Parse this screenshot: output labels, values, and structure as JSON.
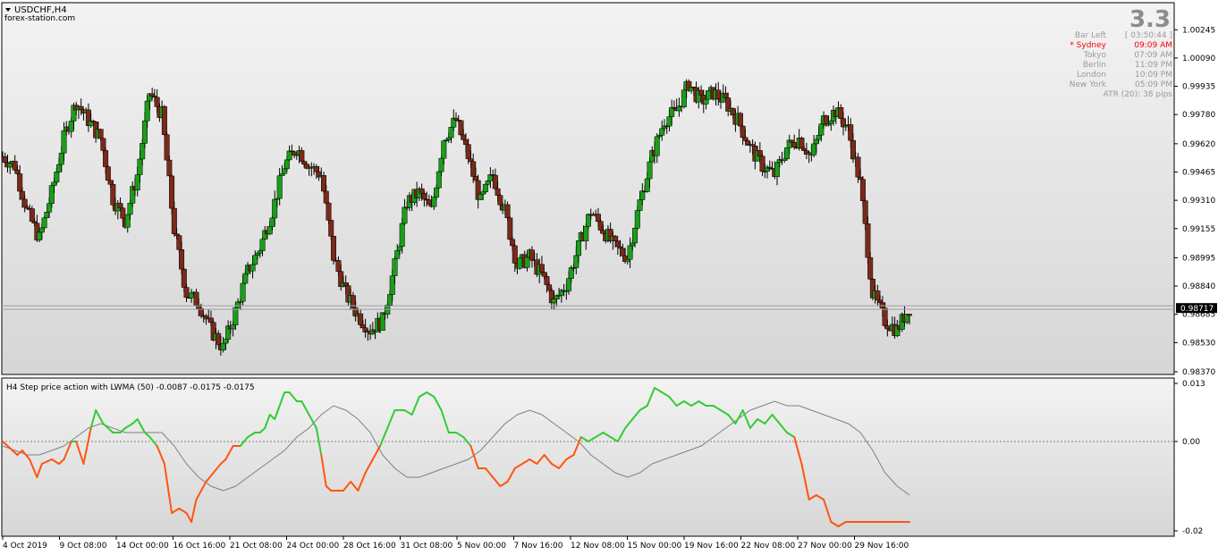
{
  "window": {
    "title": "USDCHF,H4",
    "watermark": "forex-station.com"
  },
  "info_panel": {
    "spread": "3.3",
    "bar_left_label": "Bar Left",
    "bar_left_value": "[ 03:50:44 ]",
    "sessions": [
      {
        "name": "* Sydney",
        "time": "09:09 AM",
        "active": true
      },
      {
        "name": "Tokyo",
        "time": "07:09 AM",
        "active": false
      },
      {
        "name": "Berlin",
        "time": "11:09 PM",
        "active": false
      },
      {
        "name": "London",
        "time": "10:09 PM",
        "active": false
      },
      {
        "name": "New York",
        "time": "05:09 PM",
        "active": false
      }
    ],
    "atr": "ATR (20): 38 pips"
  },
  "indicator": {
    "label": "H4 Step price action with LWMA (50) -0.0087 -0.0175 -0.0175"
  },
  "colors": {
    "bull_candle": "#1a9e1a",
    "bear_candle": "#7a2a1a",
    "wick": "#000000",
    "step_up": "#33cc33",
    "step_down": "#ff5511",
    "lwma": "#808080",
    "price_line": "#a0a0a0",
    "current_price_bg": "#000000",
    "sydney_active": "#ff0000",
    "info_text": "#999999"
  },
  "chart_data": [
    {
      "type": "candlestick",
      "symbol": "USDCHF",
      "timeframe": "H4",
      "current_price": 0.98717,
      "current_price_label": "0.98717",
      "ylim": [
        0.9837,
        1.0031
      ],
      "y_ticks": [
        1.00245,
        1.0009,
        0.99935,
        0.9978,
        0.9962,
        0.99465,
        0.9931,
        0.99155,
        0.98995,
        0.9884,
        0.98685,
        0.9853,
        0.9837
      ],
      "y_tick_labels": [
        "1.00245",
        "1.00090",
        "0.99935",
        "0.99780",
        "0.99620",
        "0.99465",
        "0.99310",
        "0.99155",
        "0.98995",
        "0.98840",
        "0.98685",
        "0.98530",
        "0.98370"
      ],
      "x_tick_labels": [
        "4 Oct 2019",
        "9 Oct 08:00",
        "14 Oct 00:00",
        "16 Oct 16:00",
        "21 Oct 08:00",
        "24 Oct 00:00",
        "28 Oct 16:00",
        "31 Oct 08:00",
        "5 Nov 00:00",
        "7 Nov 16:00",
        "12 Nov 08:00",
        "15 Nov 00:00",
        "19 Nov 16:00",
        "22 Nov 08:00",
        "27 Nov 00:00",
        "29 Nov 16:00"
      ],
      "close_path": [
        [
          0,
          0.9955
        ],
        [
          5,
          0.995
        ],
        [
          10,
          0.9925
        ],
        [
          15,
          0.991
        ],
        [
          20,
          0.9935
        ],
        [
          25,
          0.9965
        ],
        [
          30,
          0.9985
        ],
        [
          35,
          0.9975
        ],
        [
          40,
          0.9965
        ],
        [
          45,
          0.9932
        ],
        [
          50,
          0.992
        ],
        [
          55,
          0.9945
        ],
        [
          60,
          0.999
        ],
        [
          65,
          0.9978
        ],
        [
          70,
          0.9915
        ],
        [
          75,
          0.988
        ],
        [
          80,
          0.9875
        ],
        [
          85,
          0.986
        ],
        [
          90,
          0.985
        ],
        [
          95,
          0.987
        ],
        [
          100,
          0.9892
        ],
        [
          105,
          0.9905
        ],
        [
          110,
          0.9925
        ],
        [
          115,
          0.995
        ],
        [
          120,
          0.996
        ],
        [
          125,
          0.995
        ],
        [
          130,
          0.9945
        ],
        [
          135,
          0.99
        ],
        [
          140,
          0.988
        ],
        [
          145,
          0.9868
        ],
        [
          150,
          0.986
        ],
        [
          155,
          0.9865
        ],
        [
          160,
          0.9895
        ],
        [
          165,
          0.993
        ],
        [
          170,
          0.9935
        ],
        [
          175,
          0.9925
        ],
        [
          180,
          0.9965
        ],
        [
          185,
          0.9975
        ],
        [
          190,
          0.9955
        ],
        [
          195,
          0.993
        ],
        [
          200,
          0.9945
        ],
        [
          205,
          0.9925
        ],
        [
          210,
          0.9895
        ],
        [
          215,
          0.99
        ],
        [
          220,
          0.989
        ],
        [
          225,
          0.9875
        ],
        [
          230,
          0.9885
        ],
        [
          235,
          0.9905
        ],
        [
          240,
          0.9925
        ],
        [
          245,
          0.9915
        ],
        [
          250,
          0.9905
        ],
        [
          255,
          0.99
        ],
        [
          260,
          0.993
        ],
        [
          265,
          0.9955
        ],
        [
          270,
          0.9975
        ],
        [
          275,
          0.998
        ],
        [
          280,
          0.9995
        ],
        [
          285,
          0.9985
        ],
        [
          290,
          0.999
        ],
        [
          295,
          0.9985
        ],
        [
          300,
          0.9975
        ],
        [
          305,
          0.996
        ],
        [
          310,
          0.995
        ],
        [
          315,
          0.9945
        ],
        [
          320,
          0.996
        ],
        [
          325,
          0.9965
        ],
        [
          330,
          0.9955
        ],
        [
          335,
          0.9975
        ],
        [
          340,
          0.998
        ],
        [
          345,
          0.997
        ],
        [
          350,
          0.994
        ],
        [
          355,
          0.988
        ],
        [
          360,
          0.9865
        ],
        [
          365,
          0.986
        ],
        [
          370,
          0.9872
        ]
      ]
    },
    {
      "type": "line",
      "title": "H4 Step price action with LWMA (50)",
      "ylim": [
        -0.02,
        0.013
      ],
      "y_ticks": [
        0.013,
        0.0,
        -0.02
      ],
      "y_tick_labels": [
        "0.013",
        "0.00",
        "-0.02"
      ],
      "zero_line": 0.0,
      "series": [
        {
          "color": "step",
          "x": [
            0,
            4,
            6,
            8,
            11,
            14,
            16,
            20,
            23,
            25,
            28,
            30,
            33,
            36,
            38,
            41,
            45,
            48,
            50,
            53,
            55,
            58,
            60,
            63,
            66,
            69,
            72,
            75,
            77,
            79,
            81,
            83,
            86,
            89,
            91,
            94,
            97,
            100,
            103,
            105,
            107,
            109,
            111,
            113,
            115,
            117,
            120,
            122,
            125,
            128,
            130,
            132,
            134,
            137,
            139,
            142,
            145,
            148,
            151,
            154,
            157,
            160,
            162,
            164,
            167,
            170,
            173,
            176,
            179,
            182,
            185,
            188,
            191,
            194,
            197,
            200,
            203,
            206,
            209,
            212,
            215,
            218,
            221,
            224,
            227,
            230,
            233,
            236,
            239,
            242,
            245,
            248,
            251,
            254,
            257,
            260,
            263,
            266,
            269,
            272,
            275,
            278,
            281,
            284,
            287,
            290,
            293,
            296,
            299,
            302,
            305,
            308,
            311,
            314,
            317,
            320,
            323,
            326,
            329,
            332,
            335,
            338,
            341,
            344,
            347,
            350,
            352,
            355,
            358,
            361,
            364,
            367,
            370
          ],
          "y": [
            0.0,
            -0.002,
            -0.003,
            -0.002,
            -0.004,
            -0.008,
            -0.005,
            -0.004,
            -0.005,
            -0.004,
            0.0,
            0.0,
            -0.005,
            0.003,
            0.007,
            0.004,
            0.002,
            0.002,
            0.003,
            0.004,
            0.005,
            0.002,
            0.001,
            -0.001,
            -0.005,
            -0.016,
            -0.015,
            -0.016,
            -0.018,
            -0.013,
            -0.011,
            -0.009,
            -0.007,
            -0.005,
            -0.004,
            -0.001,
            -0.001,
            0.001,
            0.002,
            0.002,
            0.003,
            0.006,
            0.005,
            0.008,
            0.011,
            0.011,
            0.009,
            0.009,
            0.006,
            0.003,
            -0.003,
            -0.01,
            -0.011,
            -0.011,
            -0.011,
            -0.009,
            -0.011,
            -0.007,
            -0.004,
            -0.001,
            0.003,
            0.007,
            0.007,
            0.007,
            0.006,
            0.01,
            0.011,
            0.01,
            0.007,
            0.002,
            0.002,
            0.001,
            -0.001,
            -0.006,
            -0.006,
            -0.008,
            -0.01,
            -0.009,
            -0.006,
            -0.005,
            -0.004,
            -0.005,
            -0.003,
            -0.005,
            -0.006,
            -0.004,
            -0.003,
            0.001,
            0.0,
            0.001,
            0.002,
            0.001,
            0.0,
            0.003,
            0.005,
            0.007,
            0.008,
            0.012,
            0.011,
            0.01,
            0.008,
            0.009,
            0.008,
            0.009,
            0.008,
            0.008,
            0.007,
            0.006,
            0.004,
            0.007,
            0.003,
            0.005,
            0.004,
            0.006,
            0.004,
            0.002,
            0.001,
            -0.005,
            -0.013,
            -0.012,
            -0.013,
            -0.018,
            -0.019,
            -0.018,
            -0.018,
            -0.018,
            -0.018,
            -0.018,
            -0.018,
            -0.018,
            -0.018,
            -0.018,
            -0.018
          ]
        },
        {
          "name": "LWMA (50)",
          "color": "lwma",
          "x": [
            0,
            5,
            10,
            15,
            20,
            25,
            30,
            35,
            40,
            45,
            50,
            55,
            60,
            65,
            70,
            75,
            80,
            85,
            90,
            95,
            100,
            105,
            110,
            115,
            120,
            125,
            130,
            135,
            140,
            145,
            150,
            155,
            160,
            165,
            170,
            175,
            180,
            185,
            190,
            195,
            200,
            205,
            210,
            215,
            220,
            225,
            230,
            235,
            240,
            245,
            250,
            255,
            260,
            265,
            270,
            275,
            280,
            285,
            290,
            295,
            300,
            305,
            310,
            315,
            320,
            325,
            330,
            335,
            340,
            345,
            350,
            355,
            360,
            365,
            370
          ],
          "y": [
            -0.001,
            -0.002,
            -0.003,
            -0.003,
            -0.002,
            -0.001,
            0.001,
            0.003,
            0.004,
            0.003,
            0.002,
            0.002,
            0.002,
            0.002,
            -0.001,
            -0.005,
            -0.008,
            -0.01,
            -0.011,
            -0.01,
            -0.008,
            -0.006,
            -0.004,
            -0.002,
            0.001,
            0.003,
            0.006,
            0.008,
            0.007,
            0.005,
            0.002,
            -0.003,
            -0.006,
            -0.008,
            -0.008,
            -0.007,
            -0.006,
            -0.005,
            -0.004,
            -0.002,
            0.001,
            0.004,
            0.006,
            0.007,
            0.006,
            0.004,
            0.002,
            0.0,
            -0.003,
            -0.005,
            -0.007,
            -0.008,
            -0.007,
            -0.005,
            -0.004,
            -0.003,
            -0.002,
            -0.001,
            0.001,
            0.003,
            0.005,
            0.007,
            0.008,
            0.009,
            0.008,
            0.008,
            0.007,
            0.006,
            0.005,
            0.004,
            0.002,
            -0.002,
            -0.007,
            -0.01,
            -0.012
          ]
        }
      ]
    }
  ]
}
